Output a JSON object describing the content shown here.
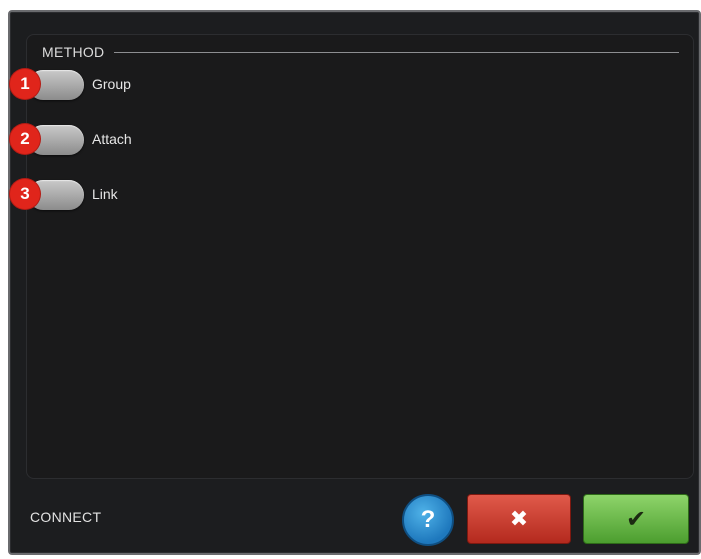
{
  "dialog": {
    "section_title": "METHOD",
    "options": [
      {
        "number": "1",
        "label": "Group"
      },
      {
        "number": "2",
        "label": "Attach"
      },
      {
        "number": "3",
        "label": "Link"
      }
    ]
  },
  "footer": {
    "title": "CONNECT",
    "help_glyph": "?",
    "cancel_glyph": "✖",
    "ok_glyph": "✔"
  },
  "colors": {
    "badge": "#e0251b",
    "help": "#2c8fd3",
    "cancel": "#cc4434",
    "ok": "#6cbb4b"
  },
  "icons": {
    "help": "question-mark-icon",
    "cancel": "x-icon",
    "ok": "checkmark-icon"
  }
}
